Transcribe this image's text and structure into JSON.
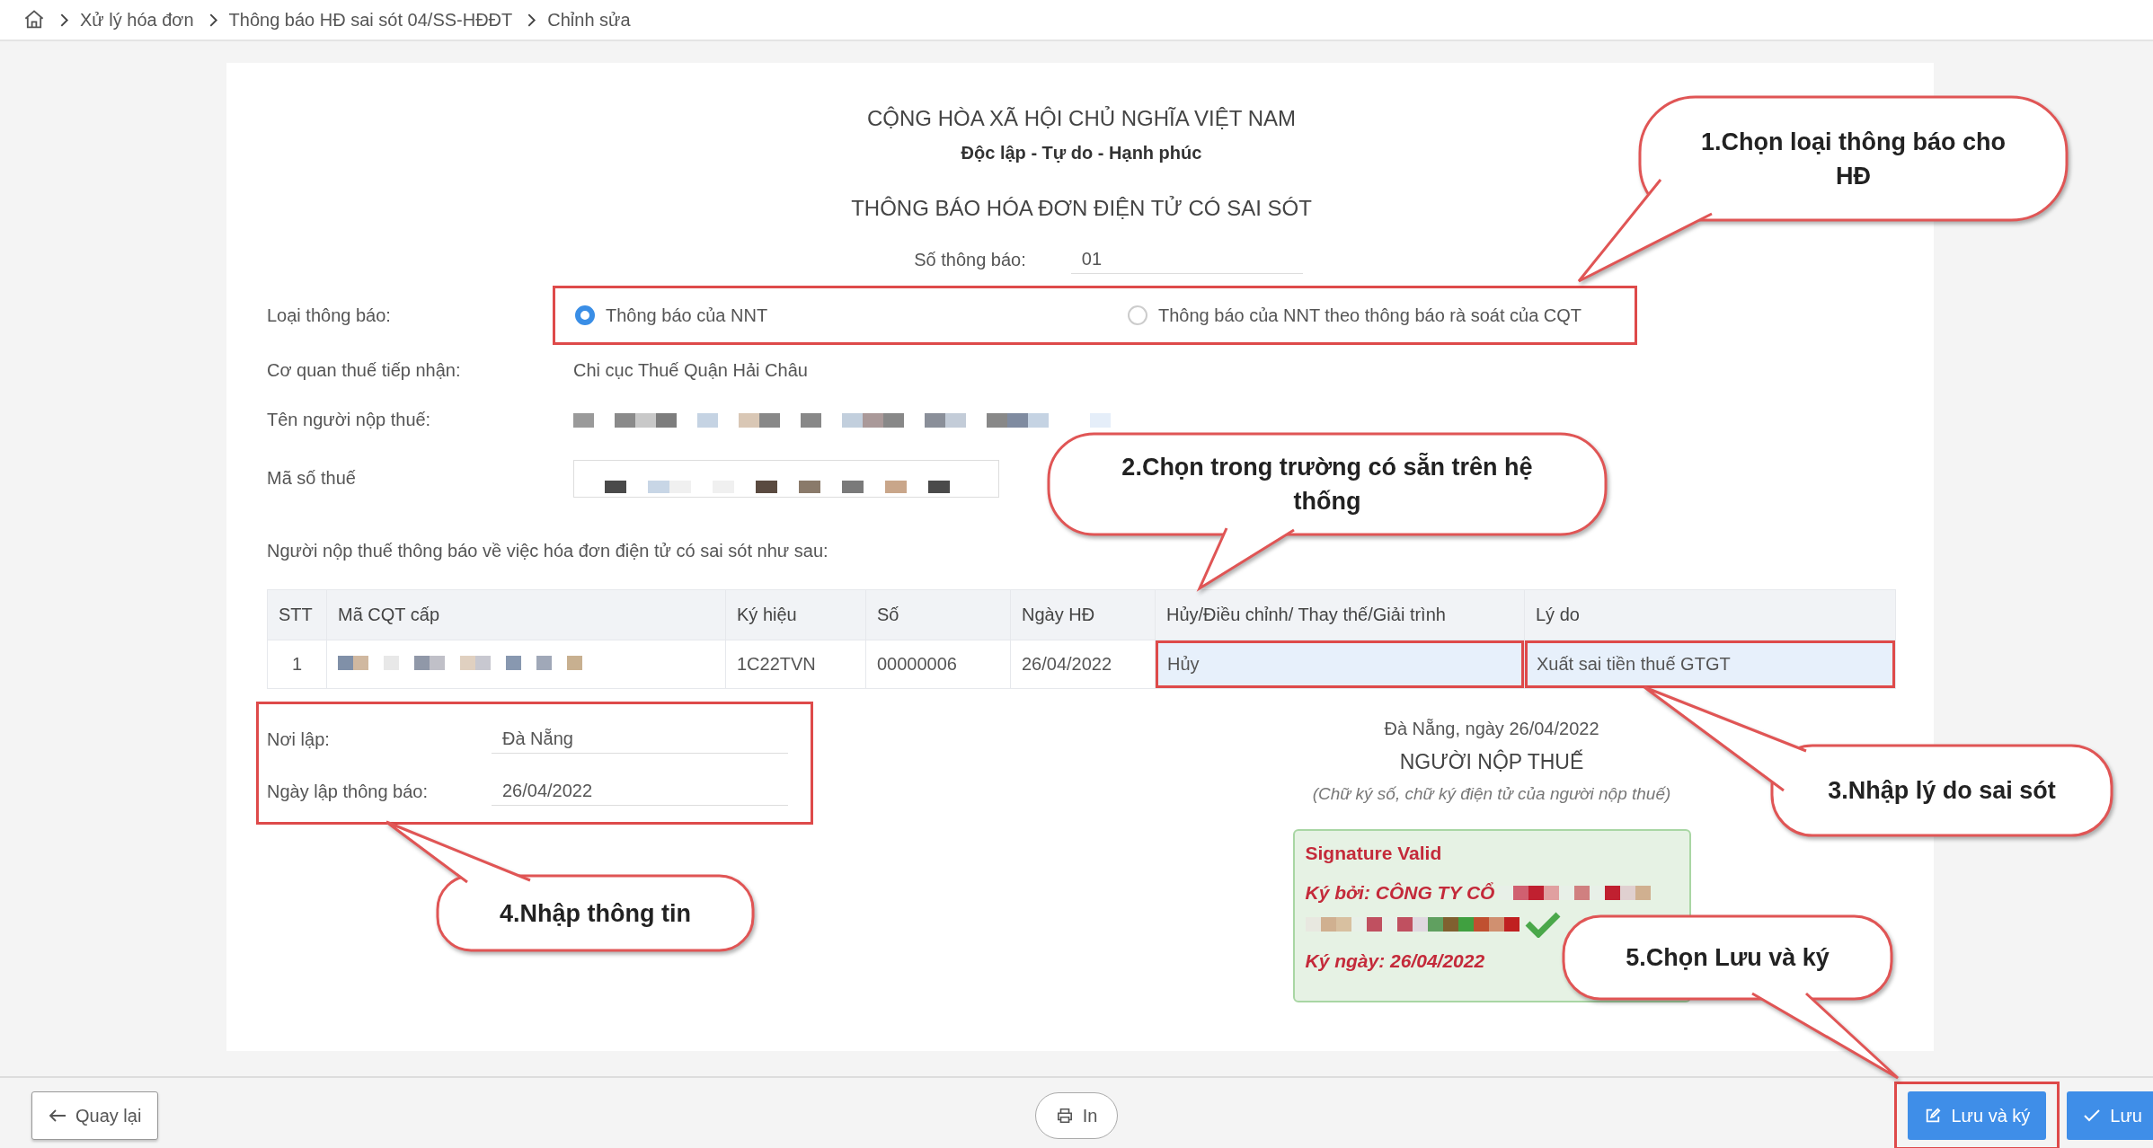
{
  "breadcrumb": [
    "Xử lý hóa đơn",
    "Thông báo HĐ sai sót 04/SS-HĐĐT",
    "Chỉnh sửa"
  ],
  "header": {
    "country": "CỘNG HÒA XÃ HỘI CHỦ NGHĨA VIỆT NAM",
    "motto": "Độc lập - Tự do - Hạnh phúc",
    "title": "THÔNG BÁO HÓA ĐƠN ĐIỆN TỬ CÓ SAI SÓT"
  },
  "notice_number": {
    "label": "Số thông báo:",
    "value": "01"
  },
  "notice_type": {
    "label": "Loại thông báo:",
    "options": [
      {
        "label": "Thông báo của NNT",
        "selected": true
      },
      {
        "label": "Thông báo của NNT theo thông báo rà soát của CQT",
        "selected": false
      }
    ]
  },
  "tax_office": {
    "label": "Cơ quan thuế tiếp nhận:",
    "value": "Chi cục Thuế Quận Hải Châu"
  },
  "taxpayer_name": {
    "label": "Tên người nộp thuế:"
  },
  "tax_code": {
    "label": "Mã số thuế"
  },
  "intro": "Người nộp thuế thông báo về việc hóa đơn điện tử có sai sót như sau:",
  "table": {
    "columns": [
      "STT",
      "Mã CQT cấp",
      "Ký hiệu",
      "Số",
      "Ngày HĐ",
      "Hủy/Điều chỉnh/ Thay thế/Giải trình",
      "Lý do"
    ],
    "rows": [
      {
        "stt": "1",
        "symbol": "1C22TVN",
        "number": "00000006",
        "date": "26/04/2022",
        "action": "Hủy",
        "reason": "Xuất sai tiền thuế GTGT"
      }
    ]
  },
  "place": {
    "label": "Nơi lập:",
    "value": "Đà Nẵng"
  },
  "date": {
    "label": "Ngày lập thông báo:",
    "value": "26/04/2022"
  },
  "signature": {
    "place_date": "Đà Nẵng, ngày 26/04/2022",
    "role": "NGƯỜI NỘP THUẾ",
    "note": "(Chữ ký số, chữ ký điện tử của người nộp thuế)",
    "stamp": {
      "status": "Signature Valid",
      "signed_by": "Ký bởi: CÔNG TY CỔ",
      "signed_on": "Ký ngày: 26/04/2022"
    }
  },
  "callouts": [
    "1.Chọn loại thông báo cho HĐ",
    "2.Chọn trong trường có sẵn trên hệ thống",
    "3.Nhập lý do sai sót",
    "4.Nhập thông tin",
    "5.Chọn Lưu và ký"
  ],
  "footer": {
    "back": "Quay lại",
    "print": "In",
    "save_sign": "Lưu và ký",
    "save": "Lưu"
  }
}
